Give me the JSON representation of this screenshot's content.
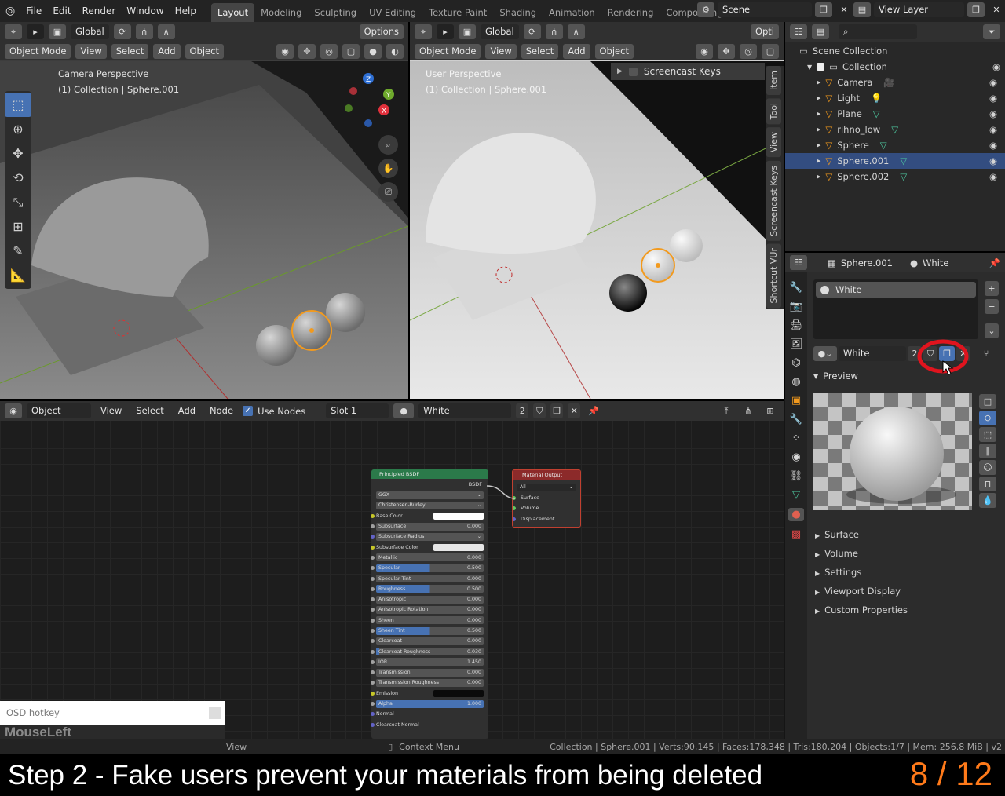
{
  "menu": {
    "items": [
      "File",
      "Edit",
      "Render",
      "Window",
      "Help"
    ],
    "workspaces": [
      "Layout",
      "Modeling",
      "Sculpting",
      "UV Editing",
      "Texture Paint",
      "Shading",
      "Animation",
      "Rendering",
      "Compositing"
    ],
    "scene_label": "Scene",
    "view_layer_label": "View Layer"
  },
  "viewport_left": {
    "orientation": "Global",
    "options": "Options",
    "mode": "Object Mode",
    "menus": [
      "View",
      "Select",
      "Add",
      "Object"
    ],
    "title": "Camera Perspective",
    "subtitle": "(1) Collection | Sphere.001",
    "gizmo": {
      "z": "Z",
      "y": "Y",
      "x": "X"
    }
  },
  "viewport_right": {
    "orientation": "Global",
    "options": "Opti",
    "mode": "Object Mode",
    "menus": [
      "View",
      "Select",
      "Add",
      "Object"
    ],
    "title": "User Perspective",
    "subtitle": "(1) Collection | Sphere.001",
    "panel_label": "Screencast Keys",
    "side_tabs": [
      "Item",
      "Tool",
      "View",
      "Screencast Keys",
      "Shortcut VUr"
    ]
  },
  "outliner": {
    "search_placeholder": "",
    "root": "Scene Collection",
    "collection": "Collection",
    "items": [
      {
        "name": "Camera",
        "selected": false
      },
      {
        "name": "Light",
        "selected": false
      },
      {
        "name": "Plane",
        "selected": false
      },
      {
        "name": "rihno_low",
        "selected": false
      },
      {
        "name": "Sphere",
        "selected": false
      },
      {
        "name": "Sphere.001",
        "selected": true
      },
      {
        "name": "Sphere.002",
        "selected": false
      }
    ]
  },
  "properties": {
    "object_name": "Sphere.001",
    "material_name": "White",
    "slot_item": "White",
    "material_field": "White",
    "user_count": "2",
    "preview_label": "Preview",
    "sections": [
      "Surface",
      "Volume",
      "Settings",
      "Viewport Display",
      "Custom Properties"
    ]
  },
  "node_editor": {
    "object_type": "Object",
    "menus": [
      "View",
      "Select",
      "Add",
      "Node"
    ],
    "use_nodes": "Use Nodes",
    "slot": "Slot 1",
    "material": "White",
    "user_count": "2",
    "bsdf_node": {
      "title": "Principled BSDF",
      "output": "BSDF",
      "distribution": "GGX",
      "subsurface_method": "Christensen-Burley",
      "inputs": [
        {
          "label": "Base Color",
          "value": "",
          "kind": "color-white"
        },
        {
          "label": "Subsurface",
          "value": "0.000",
          "fill": 0
        },
        {
          "label": "Subsurface Radius",
          "value": "",
          "kind": "dropdown"
        },
        {
          "label": "Subsurface Color",
          "value": "",
          "kind": "color-light"
        },
        {
          "label": "Metallic",
          "value": "0.000",
          "fill": 0
        },
        {
          "label": "Specular",
          "value": "0.500",
          "fill": 0.5
        },
        {
          "label": "Specular Tint",
          "value": "0.000",
          "fill": 0
        },
        {
          "label": "Roughness",
          "value": "0.500",
          "fill": 0.5
        },
        {
          "label": "Anisotropic",
          "value": "0.000",
          "fill": 0
        },
        {
          "label": "Anisotropic Rotation",
          "value": "0.000",
          "fill": 0
        },
        {
          "label": "Sheen",
          "value": "0.000",
          "fill": 0
        },
        {
          "label": "Sheen Tint",
          "value": "0.500",
          "fill": 0.5
        },
        {
          "label": "Clearcoat",
          "value": "0.000",
          "fill": 0
        },
        {
          "label": "Clearcoat Roughness",
          "value": "0.030",
          "fill": 0.03
        },
        {
          "label": "IOR",
          "value": "1.450",
          "fill": 0
        },
        {
          "label": "Transmission",
          "value": "0.000",
          "fill": 0
        },
        {
          "label": "Transmission Roughness",
          "value": "0.000",
          "fill": 0
        },
        {
          "label": "Emission",
          "value": "",
          "kind": "color-black"
        },
        {
          "label": "Alpha",
          "value": "1.000",
          "fill": 1
        },
        {
          "label": "Normal",
          "value": "",
          "kind": "socket"
        },
        {
          "label": "Clearcoat Normal",
          "value": "",
          "kind": "socket"
        }
      ]
    },
    "output_node": {
      "title": "Material Output",
      "target": "All",
      "inputs": [
        "Surface",
        "Volume",
        "Displacement"
      ]
    }
  },
  "status_bar": {
    "left": "View",
    "middle": "Context Menu",
    "right": "Collection | Sphere.001 | Verts:90,145 | Faces:178,348 | Tris:180,204 | Objects:1/7 | Mem: 256.8 MiB | v2"
  },
  "osd": {
    "title": "OSD hotkey",
    "key": "MouseLeft"
  },
  "caption": {
    "text": "Step 2 - Fake users prevent your materials from being deleted",
    "progress": "8 / 12"
  },
  "colors": {
    "accent_blue": "#4772b3",
    "selection_orange": "#f29a1e",
    "annotation_red": "#e0141e",
    "progress_orange": "#ff7a1a"
  }
}
